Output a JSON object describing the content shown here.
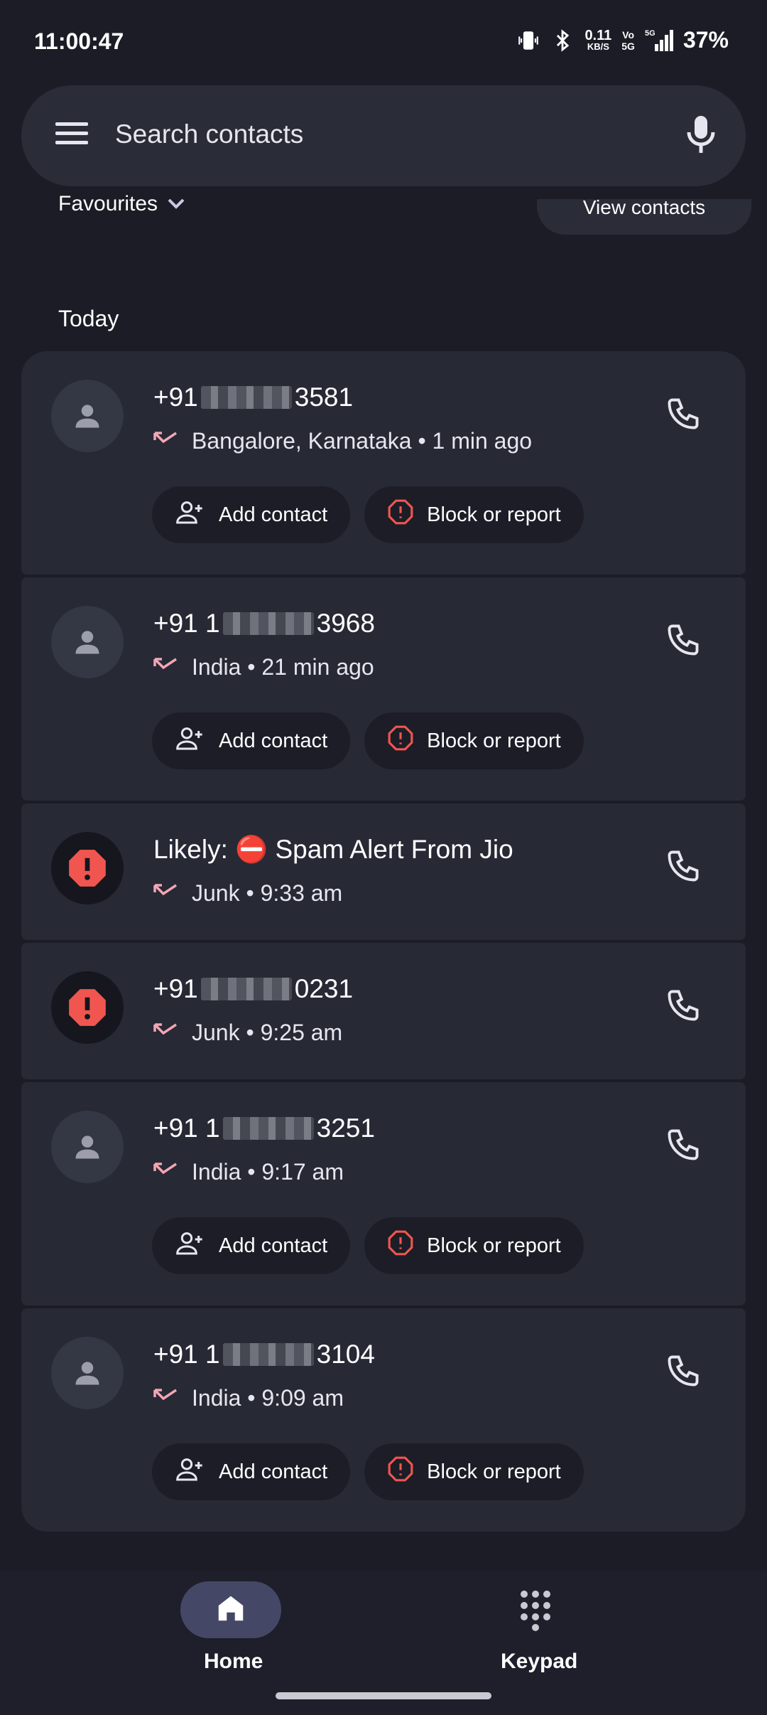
{
  "status_bar": {
    "time": "11:00:47",
    "net_speed": "0.11",
    "net_unit": "KB/S",
    "volte_top": "Vo",
    "volte_bottom": "5G",
    "signal_label": "5G",
    "battery": "37%"
  },
  "search": {
    "placeholder": "Search contacts"
  },
  "favourites": {
    "label": "Favourites",
    "view_contacts": "View contacts"
  },
  "section_title": "Today",
  "calls": [
    {
      "prefix": "+91",
      "suffix": "3581",
      "detail": "Bangalore, Karnataka • 1 min ago",
      "type": "person"
    },
    {
      "prefix": "+91 1",
      "suffix": "3968",
      "detail": "India • 21 min ago",
      "type": "person"
    },
    {
      "name": "Likely: ⛔ Spam Alert From Jio",
      "detail": "Junk • 9:33 am",
      "type": "spam"
    },
    {
      "prefix": "+91",
      "suffix": "0231",
      "detail": "Junk • 9:25 am",
      "type": "spam"
    },
    {
      "prefix": "+91 1",
      "suffix": "3251",
      "detail": "India • 9:17 am",
      "type": "person"
    },
    {
      "prefix": "+91 1",
      "suffix": "3104",
      "detail": "India • 9:09 am",
      "type": "person"
    }
  ],
  "chips": {
    "add_contact": "Add contact",
    "block_report": "Block or report"
  },
  "bottom_nav": {
    "home": "Home",
    "keypad": "Keypad"
  },
  "colors": {
    "accent_pink": "#f3a6b4",
    "spam_red": "#f0564f",
    "nav_active": "#454766"
  }
}
